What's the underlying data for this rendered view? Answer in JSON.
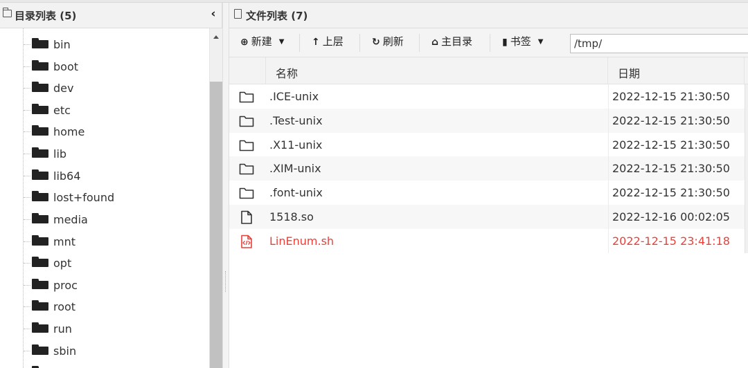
{
  "left_panel": {
    "title": "目录列表 (5)",
    "collapse_glyph": "‹",
    "items": [
      {
        "label": "bin"
      },
      {
        "label": "boot"
      },
      {
        "label": "dev"
      },
      {
        "label": "etc"
      },
      {
        "label": "home"
      },
      {
        "label": "lib"
      },
      {
        "label": "lib64"
      },
      {
        "label": "lost+found"
      },
      {
        "label": "media"
      },
      {
        "label": "mnt"
      },
      {
        "label": "opt"
      },
      {
        "label": "proc"
      },
      {
        "label": "root"
      },
      {
        "label": "run"
      },
      {
        "label": "sbin"
      }
    ]
  },
  "right_panel": {
    "title": "文件列表 (7)",
    "toolbar": {
      "new_label": "新建",
      "up_label": "上层",
      "refresh_label": "刷新",
      "home_label": "主目录",
      "bookmark_label": "书签",
      "path_value": "/tmp/"
    },
    "columns": {
      "name": "名称",
      "date": "日期"
    },
    "files": [
      {
        "name": ".ICE-unix",
        "date": "2022-12-15 21:30:50",
        "kind": "folder-icon"
      },
      {
        "name": ".Test-unix",
        "date": "2022-12-15 21:30:50",
        "kind": "folder-icon"
      },
      {
        "name": ".X11-unix",
        "date": "2022-12-15 21:30:50",
        "kind": "folder-icon"
      },
      {
        "name": ".XIM-unix",
        "date": "2022-12-15 21:30:50",
        "kind": "folder-icon"
      },
      {
        "name": ".font-unix",
        "date": "2022-12-15 21:30:50",
        "kind": "folder-icon"
      },
      {
        "name": "1518.so",
        "date": "2022-12-16 00:02:05",
        "kind": "file-icon"
      },
      {
        "name": "LinEnum.sh",
        "date": "2022-12-15 23:41:18",
        "kind": "code-file-icon"
      }
    ]
  },
  "colors": {
    "accent_red": "#e8413a",
    "header_bg": "#f2f2f2",
    "alt_row_bg": "#f7f7f7"
  }
}
